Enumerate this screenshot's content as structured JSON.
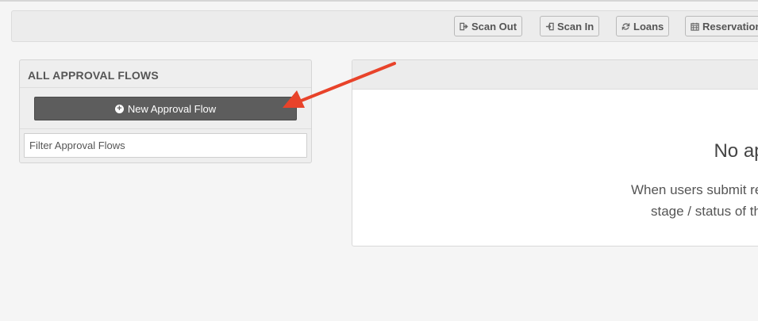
{
  "toolbar": {
    "buttons": [
      {
        "label": "Scan Out",
        "icon": "sign-out-icon"
      },
      {
        "label": "Scan In",
        "icon": "sign-in-icon"
      },
      {
        "label": "Loans",
        "icon": "refresh-icon"
      },
      {
        "label": "Reservation",
        "icon": "calendar-icon"
      }
    ]
  },
  "left_panel": {
    "heading": "ALL APPROVAL FLOWS",
    "new_button_label": "New Approval Flow",
    "filter_placeholder": "Filter Approval Flows"
  },
  "main": {
    "empty_title": "No ap",
    "empty_description": "When users submit requests for equ\nstage / status of the requests."
  },
  "annotation": {
    "arrow_color": "#e8432a"
  },
  "colors": {
    "button_dark": "#5d5d5d",
    "background": "#f5f5f5"
  }
}
